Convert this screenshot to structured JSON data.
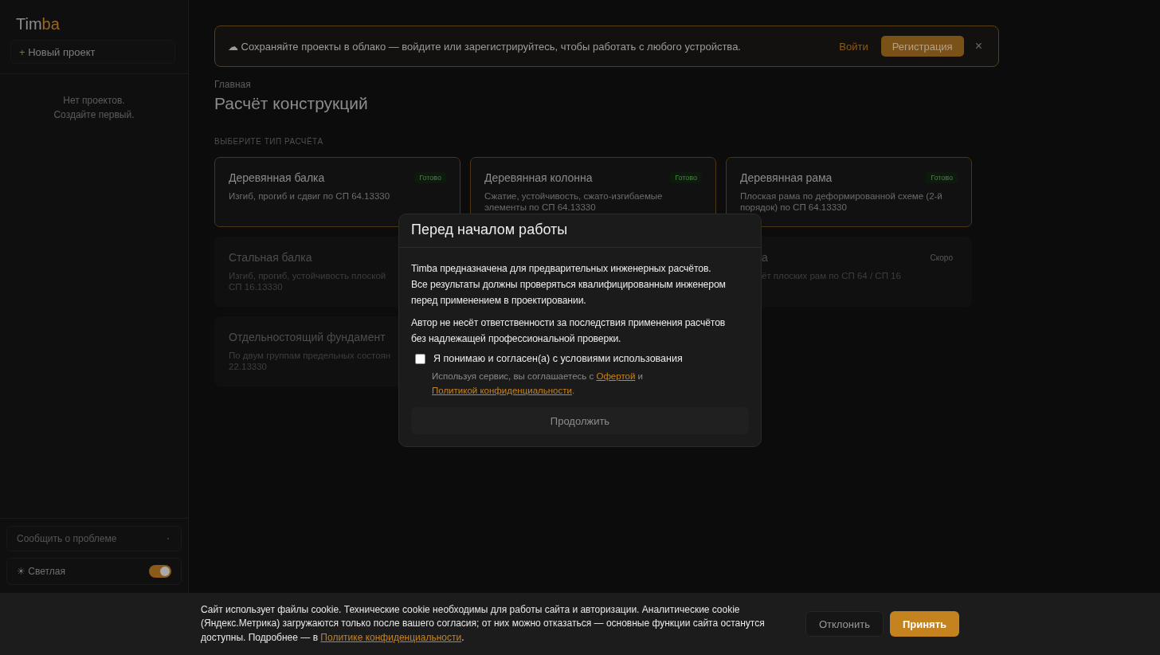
{
  "sidebar": {
    "logo": [
      "Tim",
      "ba"
    ],
    "new_project": {
      "icon": "+",
      "label": "Новый проект"
    },
    "empty": [
      "Нет проектов.",
      "Создайте первый."
    ],
    "report_field": {
      "placeholder": "Сообщить о проблеме"
    },
    "theme": {
      "icon": "☀",
      "label": "Светлая",
      "on": true
    }
  },
  "banner": {
    "icon": "☁",
    "text": "Сохраняйте проекты в облако — войдите или зарегистрируйтесь, чтобы работать с любого устройства.",
    "login": "Войти",
    "register": "Регистрация",
    "close": "×"
  },
  "breadcrumb": "Главная",
  "title": "Расчёт конструкций",
  "section_label": "ВЫБЕРИТЕ ТИП РАСЧЁТА",
  "cards": [
    {
      "available": true,
      "title": "Деревянная балка",
      "badge": "Готово",
      "description": [
        "Изгиб, прогиб и сдвиг по СП 64.13330"
      ]
    },
    {
      "available": true,
      "title": "Деревянная колонна",
      "badge": "Готово",
      "description": [
        "Сжатие, устойчивость, сжато-изгибаемые",
        "элементы по СП 64.13330"
      ]
    },
    {
      "available": true,
      "title": "Деревянная рама",
      "badge": "Готово",
      "description": [
        "Плоская рама по деформированной схеме (2-й",
        "порядок) по СП 64.13330"
      ]
    },
    {
      "available": false,
      "title": "Стальная балка",
      "description": [
        "Изгиб, прогиб, устойчивость плоской",
        "СП 16.13330"
      ]
    },
    {
      "available": false,
      "cut": true,
      "title": "а",
      "badge": "Скоро",
      "description": [
        "ёт плоских рам по СП 64 / СП 16"
      ]
    },
    {
      "available": false,
      "title": "Отдельностоящий фундамент",
      "description": [
        "По двум группам предельных состоян",
        "22.13330"
      ]
    }
  ],
  "modal": {
    "title": "Перед началом работы",
    "paragraphs": [
      [
        "Timba предназначена для предварительных инженерных расчётов.",
        "Все результаты должны проверяться квалифицированным инженером",
        "перед применением в проектировании."
      ],
      [
        "Автор не несёт ответственности за последствия применения расчётов",
        "без надлежащей профессиональной проверки."
      ]
    ],
    "agree": {
      "label": "Я понимаю и согласен(а) с условиями использования",
      "checked": false
    },
    "note": [
      {
        "kind": "text",
        "text": "Используя сервис, вы соглашаетесь с "
      },
      {
        "kind": "link",
        "text": "Офертой"
      },
      {
        "kind": "text",
        "text": " и "
      },
      {
        "kind": "link",
        "text": "Политикой конфиденциальности"
      },
      {
        "kind": "text",
        "text": "."
      }
    ],
    "continue": {
      "label": "Продолжить",
      "disabled": true
    }
  },
  "cookie": {
    "text": [
      {
        "kind": "text",
        "text": "Сайт использует файлы cookie. Технические cookie необходимы для работы сайта и авторизации. Аналитические cookie (Яндекс.Метрика) загружаются только после вашего согласия; от них можно отказаться — основные функции сайта останутся доступны. Подробнее — в "
      },
      {
        "kind": "link",
        "text": "Политике конфиденциальности"
      },
      {
        "kind": "text",
        "text": "."
      }
    ],
    "decline": "Отклонить",
    "accept": "Принять"
  }
}
